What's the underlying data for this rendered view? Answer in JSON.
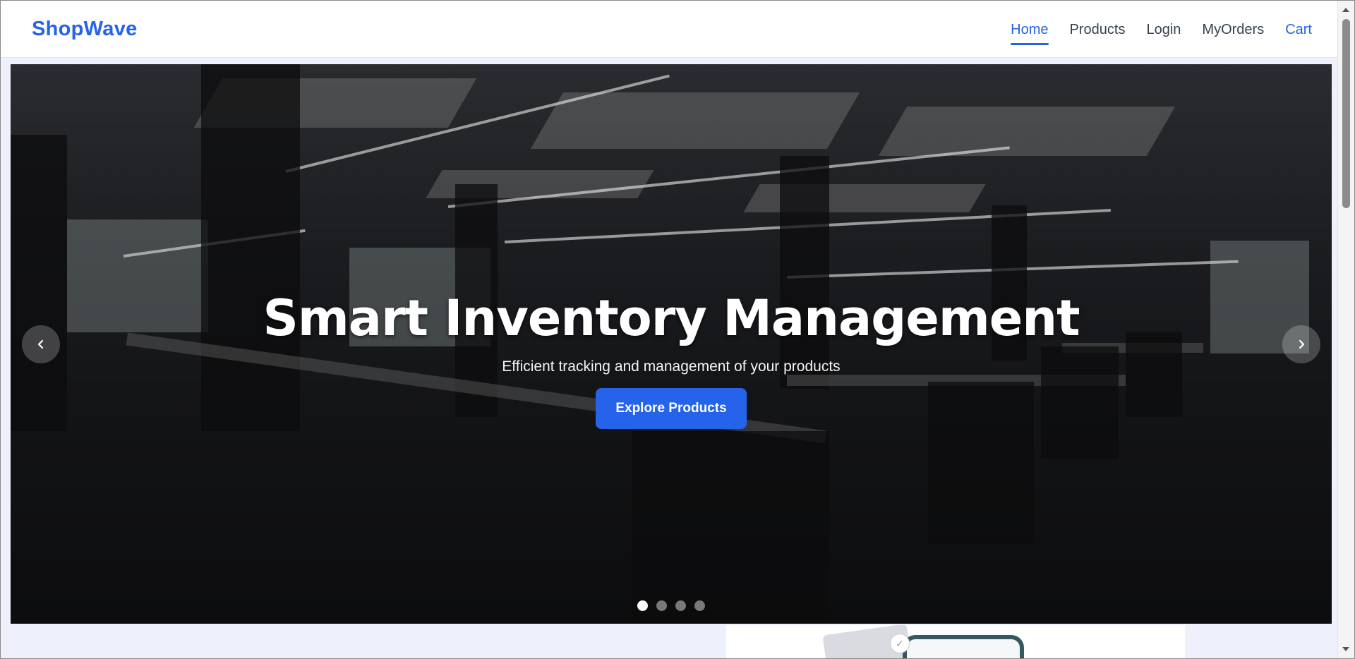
{
  "navbar": {
    "brand": "ShopWave",
    "links": [
      {
        "label": "Home",
        "active": true
      },
      {
        "label": "Products",
        "active": false
      },
      {
        "label": "Login",
        "active": false
      },
      {
        "label": "MyOrders",
        "active": false
      },
      {
        "label": "Cart",
        "active": false
      }
    ]
  },
  "hero": {
    "title": "Smart Inventory Management",
    "subtitle": "Efficient tracking and management of your products",
    "cta_label": "Explore Products",
    "prev_icon": "chevron-left-icon",
    "next_icon": "chevron-right-icon",
    "slide_count": 4,
    "active_slide": 1
  },
  "colors": {
    "accent": "#2563eb",
    "nav_text": "#374151",
    "page_background": "#eef1fb"
  }
}
